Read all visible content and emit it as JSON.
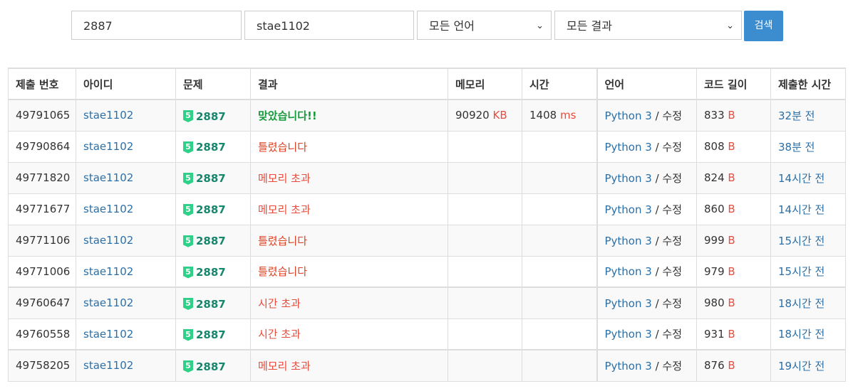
{
  "filters": {
    "problem_id": "2887",
    "user_id": "stae1102",
    "language": "모든 언어",
    "result": "모든 결과",
    "search_label": "검색"
  },
  "table": {
    "headers": [
      "제출 번호",
      "아이디",
      "문제",
      "결과",
      "메모리",
      "시간",
      "언어",
      "코드 길이",
      "제출한 시간"
    ],
    "rows": [
      {
        "id": "49791065",
        "user": "stae1102",
        "tier": "5",
        "problem": "2887",
        "result": "맞았습니다!!",
        "result_type": "ok",
        "memory": "90920",
        "memory_unit": "KB",
        "time": "1408",
        "time_unit": "ms",
        "lang": "Python 3",
        "edit": "수정",
        "code_len": "833",
        "code_unit": "B",
        "submitted": "32분 전"
      },
      {
        "id": "49790864",
        "user": "stae1102",
        "tier": "5",
        "problem": "2887",
        "result": "틀렸습니다",
        "result_type": "wa",
        "memory": "",
        "memory_unit": "",
        "time": "",
        "time_unit": "",
        "lang": "Python 3",
        "edit": "수정",
        "code_len": "808",
        "code_unit": "B",
        "submitted": "38분 전"
      },
      {
        "id": "49771820",
        "user": "stae1102",
        "tier": "5",
        "problem": "2887",
        "result": "메모리 초과",
        "result_type": "mle",
        "memory": "",
        "memory_unit": "",
        "time": "",
        "time_unit": "",
        "lang": "Python 3",
        "edit": "수정",
        "code_len": "824",
        "code_unit": "B",
        "submitted": "14시간 전"
      },
      {
        "id": "49771677",
        "user": "stae1102",
        "tier": "5",
        "problem": "2887",
        "result": "메모리 초과",
        "result_type": "mle",
        "memory": "",
        "memory_unit": "",
        "time": "",
        "time_unit": "",
        "lang": "Python 3",
        "edit": "수정",
        "code_len": "860",
        "code_unit": "B",
        "submitted": "14시간 전"
      },
      {
        "id": "49771106",
        "user": "stae1102",
        "tier": "5",
        "problem": "2887",
        "result": "틀렸습니다",
        "result_type": "wa",
        "memory": "",
        "memory_unit": "",
        "time": "",
        "time_unit": "",
        "lang": "Python 3",
        "edit": "수정",
        "code_len": "999",
        "code_unit": "B",
        "submitted": "15시간 전"
      },
      {
        "id": "49771006",
        "user": "stae1102",
        "tier": "5",
        "problem": "2887",
        "result": "틀렸습니다",
        "result_type": "wa",
        "memory": "",
        "memory_unit": "",
        "time": "",
        "time_unit": "",
        "lang": "Python 3",
        "edit": "수정",
        "code_len": "979",
        "code_unit": "B",
        "submitted": "15시간 전"
      },
      {
        "id": "49760647",
        "user": "stae1102",
        "tier": "5",
        "problem": "2887",
        "result": "시간 초과",
        "result_type": "tle",
        "memory": "",
        "memory_unit": "",
        "time": "",
        "time_unit": "",
        "lang": "Python 3",
        "edit": "수정",
        "code_len": "980",
        "code_unit": "B",
        "submitted": "18시간 전"
      },
      {
        "id": "49760558",
        "user": "stae1102",
        "tier": "5",
        "problem": "2887",
        "result": "시간 초과",
        "result_type": "tle",
        "memory": "",
        "memory_unit": "",
        "time": "",
        "time_unit": "",
        "lang": "Python 3",
        "edit": "수정",
        "code_len": "931",
        "code_unit": "B",
        "submitted": "18시간 전"
      },
      {
        "id": "49758205",
        "user": "stae1102",
        "tier": "5",
        "problem": "2887",
        "result": "메모리 초과",
        "result_type": "mle",
        "memory": "",
        "memory_unit": "",
        "time": "",
        "time_unit": "",
        "lang": "Python 3",
        "edit": "수정",
        "code_len": "876",
        "code_unit": "B",
        "submitted": "19시간 전"
      }
    ]
  }
}
